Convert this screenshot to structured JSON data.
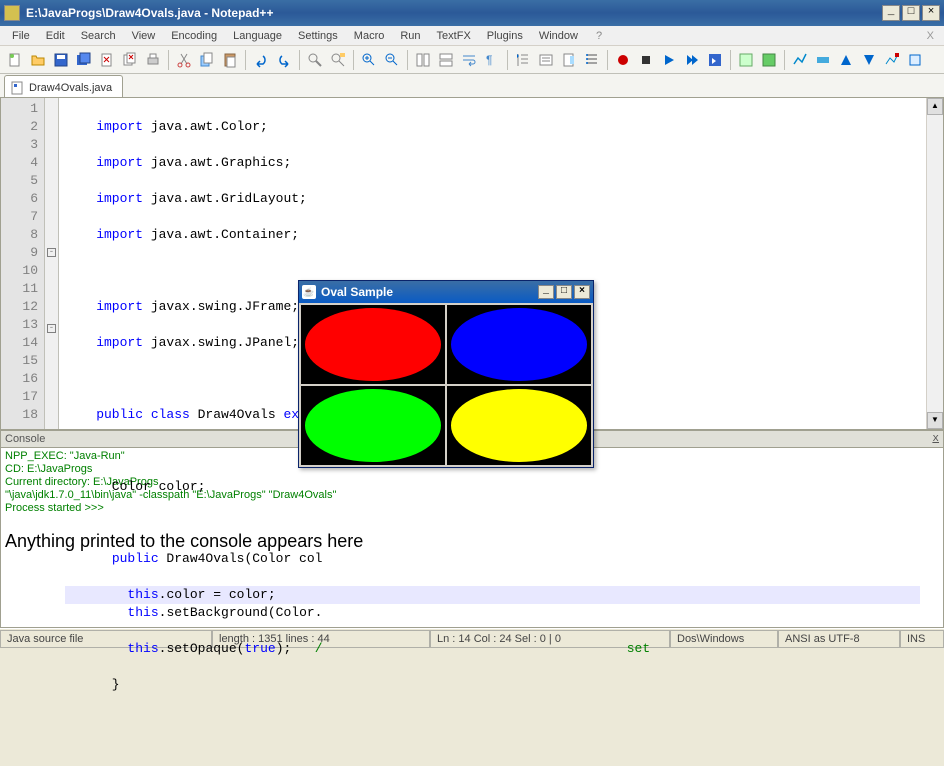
{
  "window": {
    "title": "E:\\JavaProgs\\Draw4Ovals.java - Notepad++"
  },
  "menu": {
    "items": [
      "File",
      "Edit",
      "Search",
      "View",
      "Encoding",
      "Language",
      "Settings",
      "Macro",
      "Run",
      "TextFX",
      "Plugins",
      "Window",
      "?"
    ]
  },
  "tab": {
    "label": "Draw4Ovals.java"
  },
  "code": {
    "lines": [
      1,
      2,
      3,
      4,
      5,
      6,
      7,
      8,
      9,
      10,
      11,
      12,
      13,
      14,
      15,
      16,
      17,
      18
    ],
    "l1": "    import java.awt.Color;",
    "l2": "    import java.awt.Graphics;",
    "l3": "    import java.awt.GridLayout;",
    "l4": "    import java.awt.Container;",
    "l5": "",
    "l6": "    import javax.swing.JFrame;",
    "l7": "    import javax.swing.JPanel;",
    "l8": "",
    "l9": "    public class Draw4Ovals extends JPanel {",
    "l10": "",
    "l11": "      Color color;",
    "l12": "",
    "l13": "      public Draw4Ovals(Color col",
    "l14": "        this.color = color;",
    "l15": "        this.setBackground(Color.",
    "l16a": "        this.setOpaque(true);   ",
    "l16b": "set",
    "l17": "      }",
    "l18": ""
  },
  "console": {
    "header": "Console",
    "l1": "NPP_EXEC: \"Java-Run\"",
    "l2": "CD: E:\\JavaProgs",
    "l3": "Current directory: E:\\JavaProgs",
    "l4": "\"\\java\\jdk1.7.0_11\\bin\\java\"  -classpath \"E:\\JavaProgs\" \"Draw4Ovals\"",
    "l5": "Process started >>>",
    "msg": "Anything printed to the console appears here"
  },
  "status": {
    "filetype": "Java source file",
    "length": "length : 1351    lines : 44",
    "pos": "Ln : 14    Col : 24    Sel : 0 | 0",
    "eol": "Dos\\Windows",
    "enc": "ANSI as UTF-8",
    "ins": "INS"
  },
  "oval": {
    "title": "Oval Sample",
    "colors": {
      "tl": "#ff0000",
      "tr": "#0000ff",
      "bl": "#00ff00",
      "br": "#ffff00"
    }
  }
}
